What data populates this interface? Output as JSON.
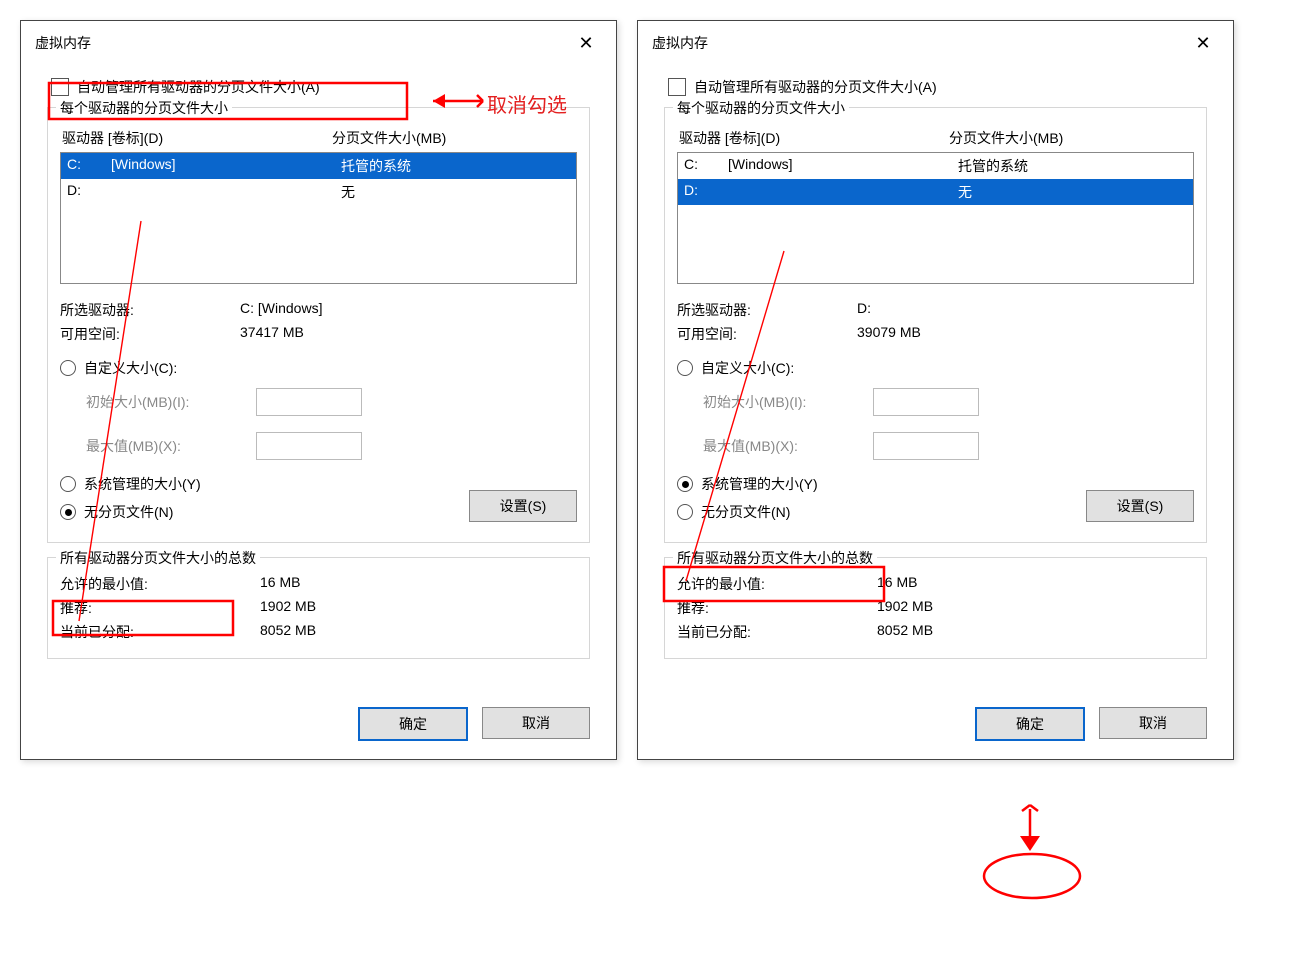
{
  "annotation_text": "取消勾选",
  "left": {
    "title": "虚拟内存",
    "auto_label": "自动管理所有驱动器的分页文件大小(A)",
    "group1_label": "每个驱动器的分页文件大小",
    "col1": "驱动器 [卷标](D)",
    "col2": "分页文件大小(MB)",
    "drives": [
      {
        "letter": "C:",
        "label": "[Windows]",
        "size": "托管的系统",
        "sel": true
      },
      {
        "letter": "D:",
        "label": "",
        "size": "无",
        "sel": false
      }
    ],
    "selected_drive_label": "所选驱动器:",
    "selected_drive_value": "C:  [Windows]",
    "free_space_label": "可用空间:",
    "free_space_value": "37417 MB",
    "radio_custom": "自定义大小(C):",
    "init_label": "初始大小(MB)(I):",
    "max_label": "最大值(MB)(X):",
    "radio_system": "系统管理的大小(Y)",
    "radio_none": "无分页文件(N)",
    "set_btn": "设置(S)",
    "group2_label": "所有驱动器分页文件大小的总数",
    "min_label": "允许的最小值:",
    "min_value": "16 MB",
    "rec_label": "推荐:",
    "rec_value": "1902 MB",
    "cur_label": "当前已分配:",
    "cur_value": "8052 MB",
    "ok": "确定",
    "cancel": "取消",
    "selected_radio": "none"
  },
  "right": {
    "title": "虚拟内存",
    "auto_label": "自动管理所有驱动器的分页文件大小(A)",
    "group1_label": "每个驱动器的分页文件大小",
    "col1": "驱动器 [卷标](D)",
    "col2": "分页文件大小(MB)",
    "drives": [
      {
        "letter": "C:",
        "label": "[Windows]",
        "size": "托管的系统",
        "sel": false
      },
      {
        "letter": "D:",
        "label": "",
        "size": "无",
        "sel": true
      }
    ],
    "selected_drive_label": "所选驱动器:",
    "selected_drive_value": "D:",
    "free_space_label": "可用空间:",
    "free_space_value": "39079 MB",
    "radio_custom": "自定义大小(C):",
    "init_label": "初始大小(MB)(I):",
    "max_label": "最大值(MB)(X):",
    "radio_system": "系统管理的大小(Y)",
    "radio_none": "无分页文件(N)",
    "set_btn": "设置(S)",
    "group2_label": "所有驱动器分页文件大小的总数",
    "min_label": "允许的最小值:",
    "min_value": "16 MB",
    "rec_label": "推荐:",
    "rec_value": "1902 MB",
    "cur_label": "当前已分配:",
    "cur_value": "8052 MB",
    "ok": "确定",
    "cancel": "取消",
    "selected_radio": "system"
  }
}
